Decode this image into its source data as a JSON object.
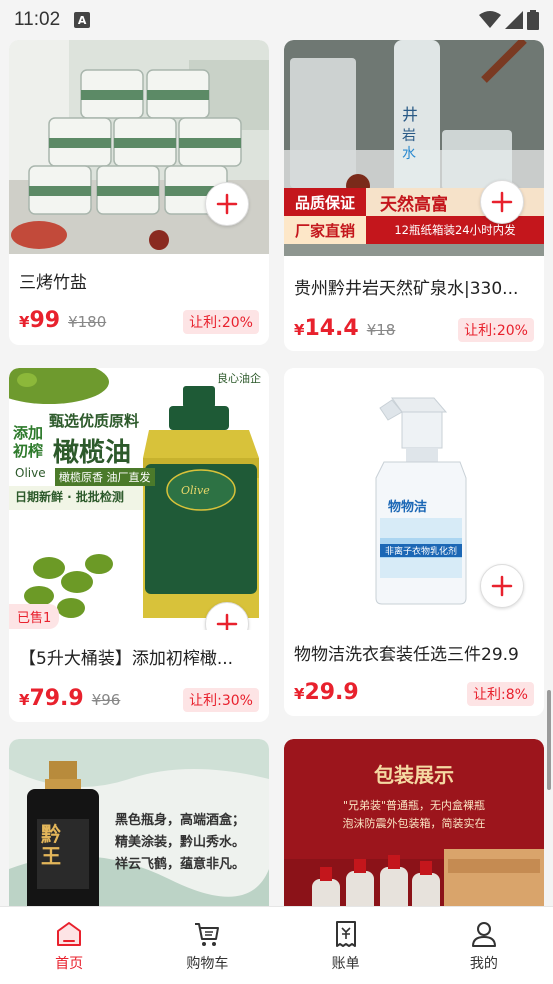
{
  "status_bar": {
    "time": "11:02",
    "notification_glyph": "A"
  },
  "products": [
    {
      "title": "三烤竹盐",
      "price": "99",
      "old_price": "¥180",
      "rebate": "让利:20%",
      "currency": "¥"
    },
    {
      "title": "贵州黔井岩天然矿泉水|330...",
      "price": "14.4",
      "old_price": "¥18",
      "rebate": "让利:20%",
      "currency": "¥",
      "banner": {
        "quality": "品质保证",
        "factory": "厂家直销",
        "natural": "天然高富",
        "shipping": "12瓶纸箱装24小时内发"
      }
    },
    {
      "title": "【5升大桶装】添加初榨橄...",
      "price": "79.9",
      "old_price": "¥96",
      "rebate": "让利:30%",
      "currency": "¥",
      "sold": "已售1",
      "poster": {
        "brand_tag": "良心油企",
        "headline": "甄选优质原料",
        "product": "橄榄油",
        "side": "添加初榨",
        "olive_en": "Olive",
        "sub": "橄榄原香 油厂直发",
        "fresh": "日期新鲜 · 批批检测"
      }
    },
    {
      "title": "物物洁洗衣套装任选三件29.9",
      "price": "29.9",
      "old_price": "",
      "rebate": "让利:8%",
      "currency": "¥",
      "bottle": {
        "brand": "物物洁",
        "label": "非离子衣物乳化剂"
      }
    },
    {
      "poster": {
        "line1": "黑色瓶身，高端酒盒；",
        "line2": "精美涂装，黔山秀水。",
        "line3": "祥云飞鹤，蕴意非凡。",
        "bottle_name": "黔王"
      }
    },
    {
      "poster": {
        "headline": "包装展示",
        "line1": "\"兄弟装\"普通瓶，无内盒裸瓶",
        "line2": "泡沫防震外包装箱，简装实在"
      }
    }
  ],
  "tabs": [
    {
      "label": "首页",
      "icon": "home-icon",
      "active": true
    },
    {
      "label": "购物车",
      "icon": "cart-icon",
      "active": false
    },
    {
      "label": "账单",
      "icon": "bill-icon",
      "active": false
    },
    {
      "label": "我的",
      "icon": "profile-icon",
      "active": false
    }
  ],
  "colors": {
    "accent": "#e8212d",
    "rebate_bg": "#fde4e5",
    "page_bg": "#f4f4f4"
  }
}
